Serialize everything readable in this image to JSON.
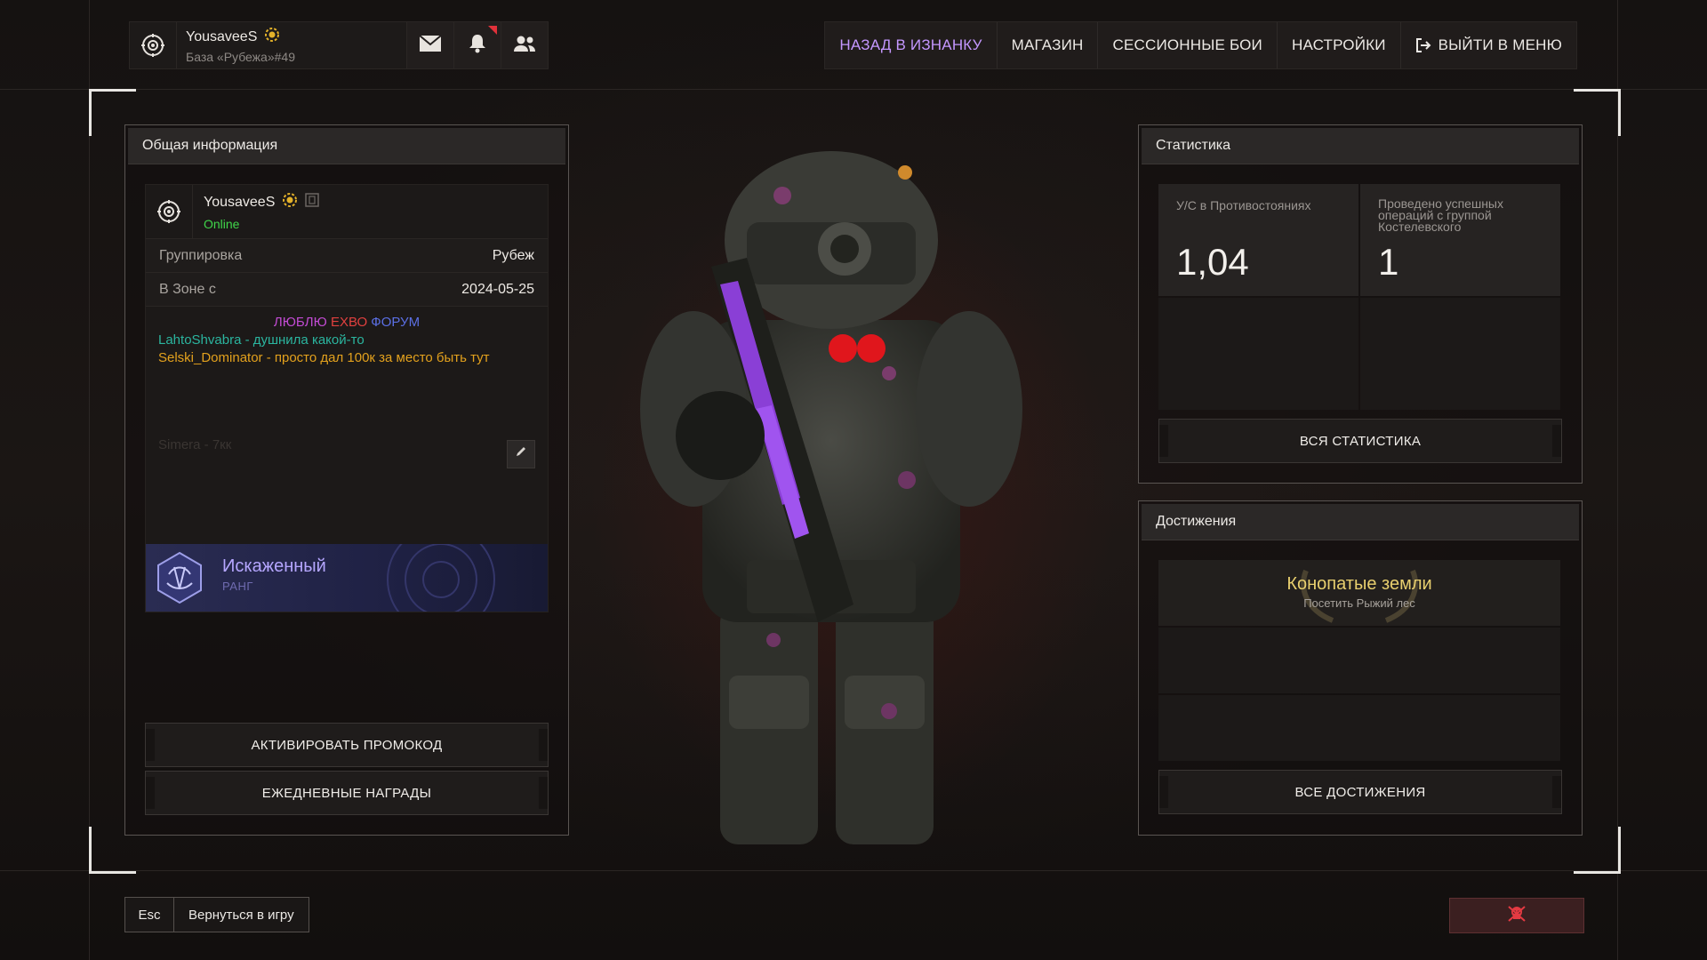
{
  "player": {
    "name": "YousaveeS",
    "base": "База «Рубежа»#49",
    "status": "Online"
  },
  "nav": {
    "items": [
      {
        "label": "НАЗАД В ИЗНАНКУ",
        "active": true
      },
      {
        "label": "МАГАЗИН"
      },
      {
        "label": "СЕССИОННЫЕ БОИ"
      },
      {
        "label": "НАСТРОЙКИ"
      },
      {
        "label": "ВЫЙТИ В МЕНЮ"
      }
    ]
  },
  "general": {
    "title": "Общая информация",
    "faction_label": "Группировка",
    "faction_value": "Рубеж",
    "zone_label": "В Зоне с",
    "zone_value": "2024-05-25",
    "bio": {
      "line1_a": "ЛЮБЛЮ",
      "line1_b": "ЕХВО",
      "line1_c": "ФОРУМ",
      "line2": "LahtoShvabra - душнила какой-то",
      "line3": "Selski_Dominator - просто дал 100к за место быть тут",
      "line4": "Simera - 7кк"
    },
    "rank_name": "Искаженный",
    "rank_label": "РАНГ",
    "promo_button": "АКТИВИРОВАТЬ ПРОМОКОД",
    "daily_button": "ЕЖЕДНЕВНЫЕ НАГРАДЫ"
  },
  "stats": {
    "title": "Статистика",
    "kd_label": "У/С в Противостояниях",
    "kd_value": "1,04",
    "ops_label": "Проведено успешных операций с группой Костелевского",
    "ops_value": "1",
    "all_button": "ВСЯ СТАТИСТИКА"
  },
  "achievements": {
    "title": "Достижения",
    "item_title": "Конопатые земли",
    "item_desc": "Посетить Рыжий лес",
    "all_button": "ВСЕ ДОСТИЖЕНИЯ"
  },
  "footer": {
    "esc_key": "Esc",
    "return_label": "Вернуться в игру"
  },
  "colors": {
    "accent": "#c497ff",
    "online": "#3fd64a",
    "gold": "#e8cf6e",
    "bio_teal": "#2bb59f",
    "bio_orange": "#e3a11d"
  },
  "icons": [
    "faction-emblem-icon",
    "premium-badge-icon",
    "mail-icon",
    "bell-icon",
    "friends-icon",
    "exit-icon",
    "copy-icon",
    "edit-icon",
    "rank-emblem-icon",
    "report-icon"
  ]
}
